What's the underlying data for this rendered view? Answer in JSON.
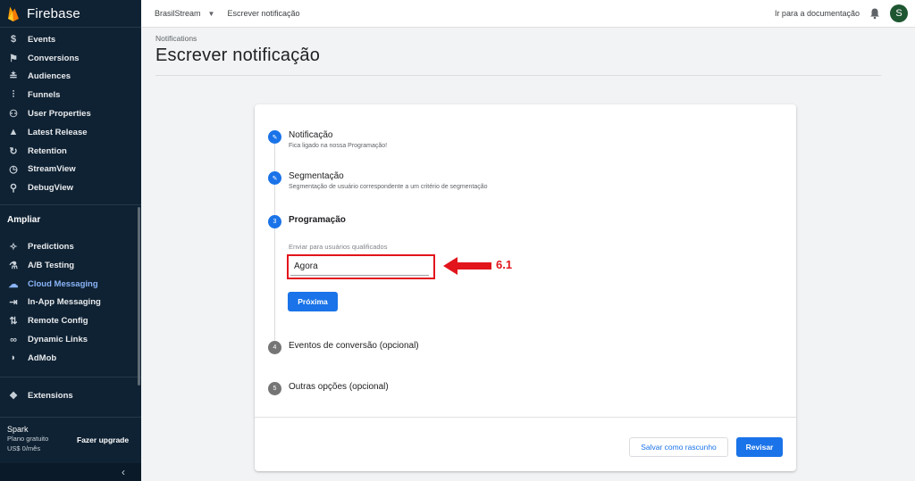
{
  "app": {
    "name": "Firebase"
  },
  "sidebar": {
    "items_top": [
      {
        "label": "Events",
        "icon": "dollar-icon"
      },
      {
        "label": "Conversions",
        "icon": "flag-icon"
      },
      {
        "label": "Audiences",
        "icon": "audiences-icon"
      },
      {
        "label": "Funnels",
        "icon": "funnel-icon"
      },
      {
        "label": "User Properties",
        "icon": "user-properties-icon"
      },
      {
        "label": "Latest Release",
        "icon": "latest-release-icon"
      },
      {
        "label": "Retention",
        "icon": "retention-icon"
      },
      {
        "label": "StreamView",
        "icon": "clock-icon"
      },
      {
        "label": "DebugView",
        "icon": "debug-icon"
      }
    ],
    "section_title": "Ampliar",
    "items_grow": [
      {
        "label": "Predictions",
        "icon": "wand-icon"
      },
      {
        "label": "A/B Testing",
        "icon": "flask-icon"
      },
      {
        "label": "Cloud Messaging",
        "icon": "cloud-messaging-icon",
        "active": true
      },
      {
        "label": "In-App Messaging",
        "icon": "in-app-messaging-icon"
      },
      {
        "label": "Remote Config",
        "icon": "remote-config-icon"
      },
      {
        "label": "Dynamic Links",
        "icon": "link-icon"
      },
      {
        "label": "AdMob",
        "icon": "admob-icon"
      }
    ],
    "extensions_label": "Extensions",
    "plan": {
      "name": "Spark",
      "line1": "Plano gratuito",
      "line2": "US$ 0/mês",
      "upgrade": "Fazer upgrade"
    },
    "collapse_icon": "chevron-left-icon"
  },
  "topbar": {
    "project": "BrasilStream",
    "breadcrumb": "Escrever notificação",
    "docs_link": "Ir para a documentação",
    "avatar_initial": "S"
  },
  "page": {
    "pre_title": "Notifications",
    "title": "Escrever notificação"
  },
  "steps": [
    {
      "title": "Notificação",
      "subtitle": "Fica ligado na nossa Programação!",
      "state": "done"
    },
    {
      "title": "Segmentação",
      "subtitle": "Segmentação de usuário correspondente a um critério de segmentação",
      "state": "done"
    },
    {
      "number": "3",
      "title": "Programação",
      "state": "current"
    },
    {
      "number": "4",
      "title": "Eventos de conversão (opcional)",
      "state": "pending"
    },
    {
      "number": "5",
      "title": "Outras opções (opcional)",
      "state": "pending"
    }
  ],
  "schedule": {
    "field_label": "Enviar para usuários qualificados",
    "field_value": "Agora",
    "next_button": "Próxima"
  },
  "footer": {
    "draft_button": "Salvar como rascunho",
    "review_button": "Revisar"
  },
  "annotation": {
    "label": "6.1",
    "color": "#e2141c"
  },
  "colors": {
    "accent": "#1a73e8",
    "sidebar_bg": "#0f2233",
    "annotation": "#e2141c"
  }
}
